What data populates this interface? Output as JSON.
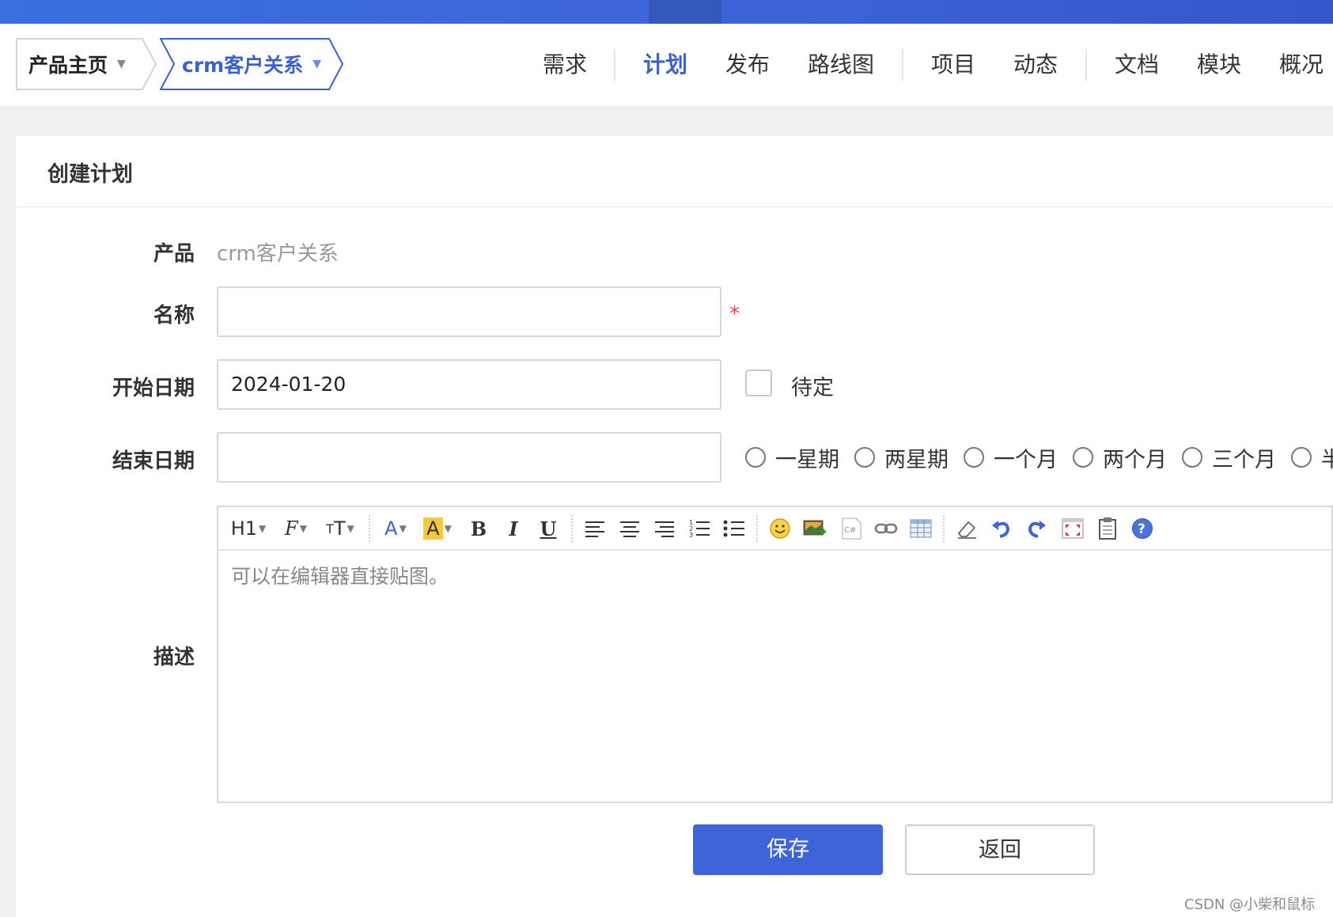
{
  "breadcrumb": {
    "product_home": "产品主页",
    "current_product": "crm客户关系"
  },
  "nav": {
    "items": [
      "需求",
      "计划",
      "发布",
      "路线图",
      "项目",
      "动态",
      "文档",
      "模块",
      "概况"
    ],
    "active": "计划"
  },
  "panel": {
    "title": "创建计划"
  },
  "form": {
    "product_label": "产品",
    "product_value": "crm客户关系",
    "name_label": "名称",
    "name_value": "",
    "required_mark": "*",
    "begin_label": "开始日期",
    "begin_value": "2024-01-20",
    "pending_label": "待定",
    "end_label": "结束日期",
    "end_value": "",
    "duration_options": [
      "一星期",
      "两星期",
      "一个月",
      "两个月",
      "三个月",
      "半"
    ],
    "desc_label": "描述",
    "desc_placeholder": "可以在编辑器直接贴图。"
  },
  "toolbar": {
    "heading": "H1",
    "font_family": "F",
    "font_size": "T",
    "font_color": "A",
    "bg_color": "A",
    "bold": "B",
    "italic": "I",
    "underline": "U"
  },
  "buttons": {
    "save": "保存",
    "back": "返回"
  },
  "watermark": "CSDN @小柴和鼠标",
  "colors": {
    "accent": "#3d64d9",
    "required": "#e04848",
    "highlight": "#f5c842"
  }
}
